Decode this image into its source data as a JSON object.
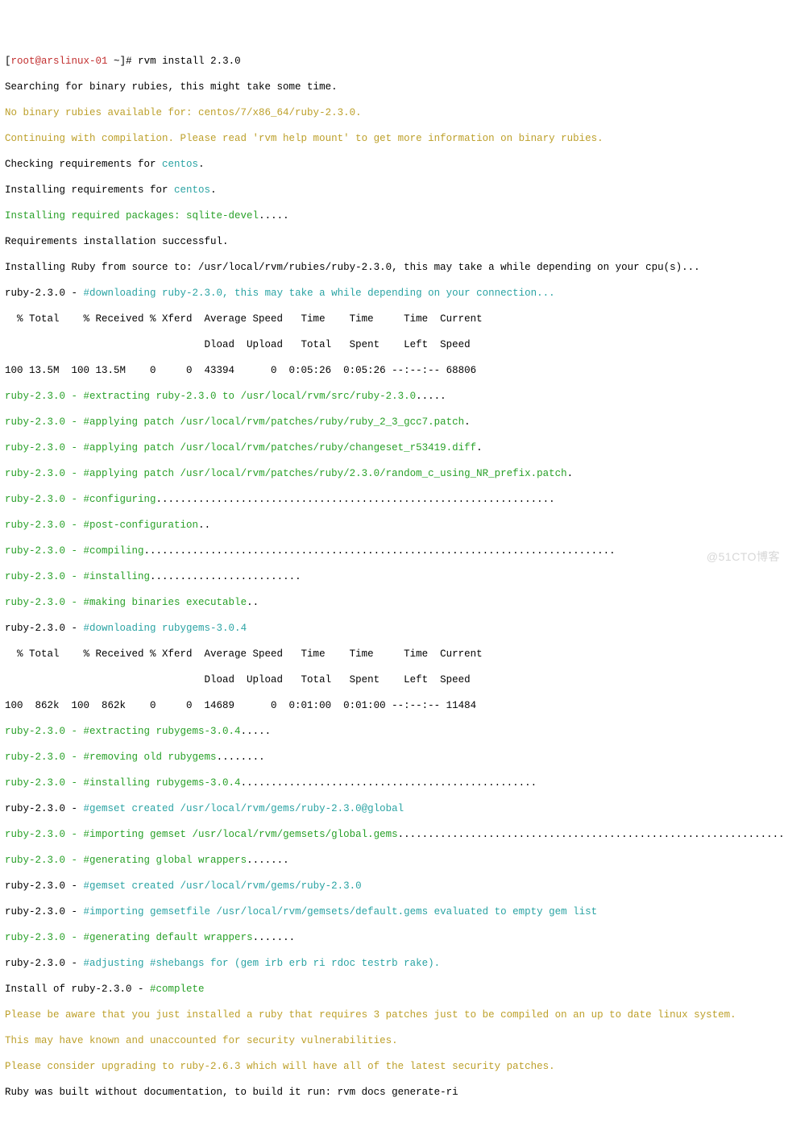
{
  "prompt": {
    "pre": "[",
    "user_host": "root@arslinux-01 ",
    "path": "~",
    "post": "]# ",
    "cmd": "rvm install 2.3.0"
  },
  "l01": "Searching for binary rubies, this might take some time.",
  "l02": "No binary rubies available for: centos/7/x86_64/ruby-2.3.0.",
  "l03": "Continuing with compilation. Please read 'rvm help mount' to get more information on binary rubies.",
  "l04": "Checking requirements for ",
  "l04b": "centos",
  "l04c": ".",
  "l05": "Installing requirements for ",
  "l05b": "centos",
  "l05c": ".",
  "l06": "Installing required packages: sqlite-devel",
  "l06b": ".....",
  "l07": "Requirements installation successful.",
  "l08": "Installing Ruby from source to: /usr/local/rvm/rubies/ruby-2.3.0, this may take a while depending on your cpu(s)...",
  "l09a": "ruby-2.3.0 - ",
  "l09b": "#downloading ruby-2.3.0, this may take a while depending on your connection...",
  "hdr1": "  % Total    % Received % Xferd  Average Speed   Time    Time     Time  Current",
  "hdr2": "                                 Dload  Upload   Total   Spent    Left  Speed",
  "dl1": "100 13.5M  100 13.5M    0     0  43394      0  0:05:26  0:05:26 --:--:-- 68806",
  "l10a": "ruby-2.3.0 - ",
  "l10b": "#extracting ruby-2.3.0 to /usr/local/rvm/src/ruby-2.3.0",
  "l10c": ".....",
  "l11a": "ruby-2.3.0 - ",
  "l11b": "#applying patch /usr/local/rvm/patches/ruby/ruby_2_3_gcc7.patch",
  "l11c": ".",
  "l12a": "ruby-2.3.0 - ",
  "l12b": "#applying patch /usr/local/rvm/patches/ruby/changeset_r53419.diff",
  "l12c": ".",
  "l13a": "ruby-2.3.0 - ",
  "l13b": "#applying patch /usr/local/rvm/patches/ruby/2.3.0/random_c_using_NR_prefix.patch",
  "l13c": ".",
  "l14a": "ruby-2.3.0 - ",
  "l14b": "#configuring",
  "l14c": "..................................................................",
  "l15a": "ruby-2.3.0 - ",
  "l15b": "#post-configuration",
  "l15c": "..",
  "l16a": "ruby-2.3.0 - ",
  "l16b": "#compiling",
  "l16c": "..............................................................................",
  "l17a": "ruby-2.3.0 - ",
  "l17b": "#installing",
  "l17c": ".........................",
  "l18a": "ruby-2.3.0 - ",
  "l18b": "#making binaries executable",
  "l18c": "..",
  "l19a": "ruby-2.3.0 - ",
  "l19b": "#downloading rubygems-3.0.4",
  "hdr3": "  % Total    % Received % Xferd  Average Speed   Time    Time     Time  Current",
  "hdr4": "                                 Dload  Upload   Total   Spent    Left  Speed",
  "dl2": "100  862k  100  862k    0     0  14689      0  0:01:00  0:01:00 --:--:-- 11484",
  "l20a": "ruby-2.3.0 - ",
  "l20b": "#extracting rubygems-3.0.4",
  "l20c": ".....",
  "l21a": "ruby-2.3.0 - ",
  "l21b": "#removing old rubygems",
  "l21c": "........",
  "l22a": "ruby-2.3.0 - ",
  "l22b": "#installing rubygems-3.0.4",
  "l22c": ".................................................",
  "l23a": "ruby-2.3.0 - ",
  "l23b": "#gemset created /usr/local/rvm/gems/ruby-2.3.0@global",
  "l24a": "ruby-2.3.0 - ",
  "l24b": "#importing gemset /usr/local/rvm/gemsets/global.gems",
  "l24c": "................................................................",
  "l25a": "ruby-2.3.0 - ",
  "l25b": "#generating global wrappers",
  "l25c": ".......",
  "l26a": "ruby-2.3.0 - ",
  "l26b": "#gemset created /usr/local/rvm/gems/ruby-2.3.0",
  "l27a": "ruby-2.3.0 - ",
  "l27b": "#importing gemsetfile /usr/local/rvm/gemsets/default.gems evaluated to empty gem list",
  "l28a": "ruby-2.3.0 - ",
  "l28b": "#generating default wrappers",
  "l28c": ".......",
  "l29a": "ruby-2.3.0 - ",
  "l29b": "#adjusting #shebangs for (gem irb erb ri rdoc testrb rake).",
  "l30": "Install of ruby-2.3.0 - ",
  "l30b": "#complete",
  "l31": "Please be aware that you just installed a ruby that requires 3 patches just to be compiled on an up to date linux system.",
  "l32": "This may have known and unaccounted for security vulnerabilities.",
  "l33": "Please consider upgrading to ruby-2.6.3 which will have all of the latest security patches.",
  "l34": "Ruby was built without documentation, to build it run: rvm docs generate-ri",
  "watermark": "@51CTO博客"
}
